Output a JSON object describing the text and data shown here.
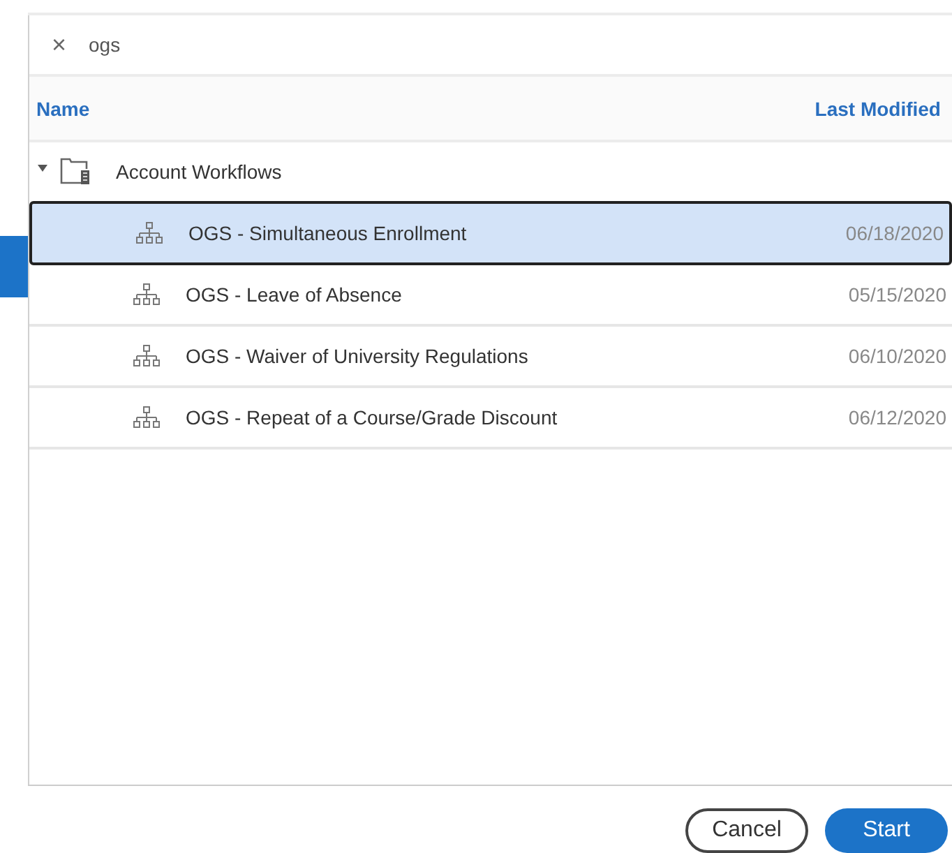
{
  "search": {
    "clear_icon": "×",
    "value": "ogs"
  },
  "table": {
    "columns": [
      "Name",
      "Last Modified"
    ],
    "folder": {
      "name": "Account Workflows",
      "expanded": true,
      "children": [
        {
          "name": "OGS - Simultaneous Enrollment",
          "modified": "06/18/2020",
          "selected": true
        },
        {
          "name": "OGS - Leave of Absence",
          "modified": "05/15/2020",
          "selected": false
        },
        {
          "name": "OGS - Waiver of University Regulations",
          "modified": "06/10/2020",
          "selected": false
        },
        {
          "name": "OGS - Repeat of a Course/Grade Discount",
          "modified": "06/12/2020",
          "selected": false
        }
      ]
    }
  },
  "buttons": [
    {
      "label": "Cancel",
      "kind": "secondary"
    },
    {
      "label": "Start",
      "kind": "primary"
    }
  ]
}
